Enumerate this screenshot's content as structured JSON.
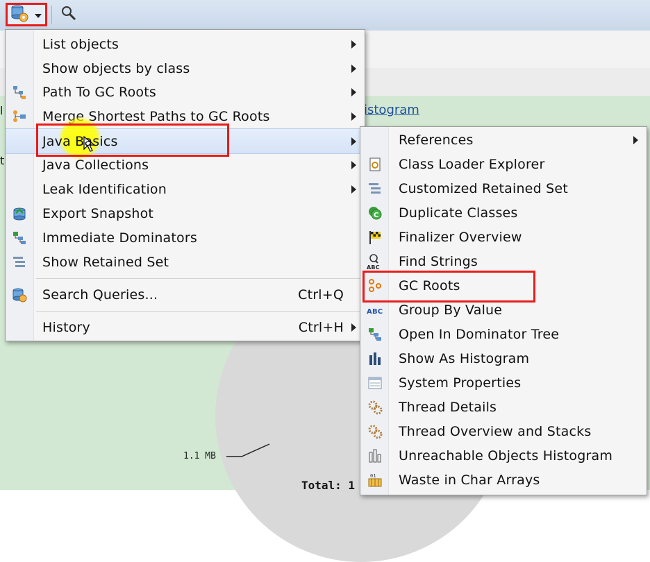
{
  "toolbar": {
    "db_button_icon": "heap-dump-icon",
    "dropdown_icon": "chevron-down-icon",
    "search_icon": "search-icon"
  },
  "background": {
    "histogram_link": "istogram",
    "pie_label": "1.1 MB",
    "total_label": "Total: 1"
  },
  "menu": {
    "items": [
      {
        "label": "List objects",
        "submenu": true
      },
      {
        "label": "Show objects by class",
        "submenu": true
      },
      {
        "label": "Path To GC Roots",
        "icon": "path-to-gc-roots-icon",
        "submenu": true
      },
      {
        "label": "Merge Shortest Paths to GC Roots",
        "icon": "merge-paths-icon",
        "submenu": true
      },
      {
        "label": "Java Basics",
        "submenu": true,
        "active": true
      },
      {
        "label": "Java Collections",
        "submenu": true
      },
      {
        "label": "Leak Identification",
        "submenu": true
      },
      {
        "label": "Export Snapshot",
        "icon": "export-snapshot-icon"
      },
      {
        "label": "Immediate Dominators",
        "icon": "immediate-dominators-icon"
      },
      {
        "label": "Show Retained Set",
        "icon": "retained-set-icon"
      },
      {
        "label": "Search Queries...",
        "icon": "search-queries-icon",
        "shortcut": "Ctrl+Q"
      },
      {
        "label": "History",
        "shortcut": "Ctrl+H",
        "submenu": true
      }
    ]
  },
  "submenu": {
    "items": [
      {
        "label": "References",
        "submenu": true
      },
      {
        "label": "Class Loader Explorer",
        "icon": "class-loader-icon"
      },
      {
        "label": "Customized Retained Set",
        "icon": "customized-retained-set-icon"
      },
      {
        "label": "Duplicate Classes",
        "icon": "duplicate-classes-icon"
      },
      {
        "label": "Finalizer Overview",
        "icon": "finalizer-icon"
      },
      {
        "label": "Find Strings",
        "icon": "find-strings-icon"
      },
      {
        "label": "GC Roots",
        "icon": "gc-roots-icon",
        "highlighted": true
      },
      {
        "label": "Group By Value",
        "icon": "group-by-value-icon"
      },
      {
        "label": "Open In Dominator Tree",
        "icon": "dominator-tree-icon"
      },
      {
        "label": "Show As Histogram",
        "icon": "histogram-icon"
      },
      {
        "label": "System Properties",
        "icon": "system-properties-icon"
      },
      {
        "label": "Thread Details",
        "icon": "thread-details-icon"
      },
      {
        "label": "Thread Overview and Stacks",
        "icon": "thread-overview-icon"
      },
      {
        "label": "Unreachable Objects Histogram",
        "icon": "unreachable-objects-icon"
      },
      {
        "label": "Waste in Char Arrays",
        "icon": "waste-char-arrays-icon"
      }
    ]
  },
  "colors": {
    "highlight_box": "#e81c1c",
    "menu_bg": "#f5f5f5",
    "hover_bg": "#d6e4f7",
    "content_bg": "#d2e8d2"
  }
}
